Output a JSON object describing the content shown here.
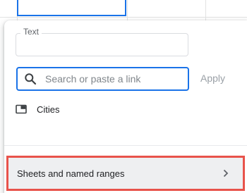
{
  "link_popup": {
    "text_field": {
      "label": "Text",
      "value": ""
    },
    "link_field": {
      "placeholder": "Search or paste a link",
      "value": ""
    },
    "apply_label": "Apply",
    "suggestions": [
      {
        "label": "Cities",
        "icon": "sheet-tab-icon"
      }
    ],
    "sheets_and_ranges": {
      "label": "Sheets and named ranges",
      "icon": "chevron-right-icon"
    }
  },
  "colors": {
    "accent": "#1a73e8",
    "highlight_border": "#e8534b",
    "row_highlight": "#eeeff1"
  }
}
